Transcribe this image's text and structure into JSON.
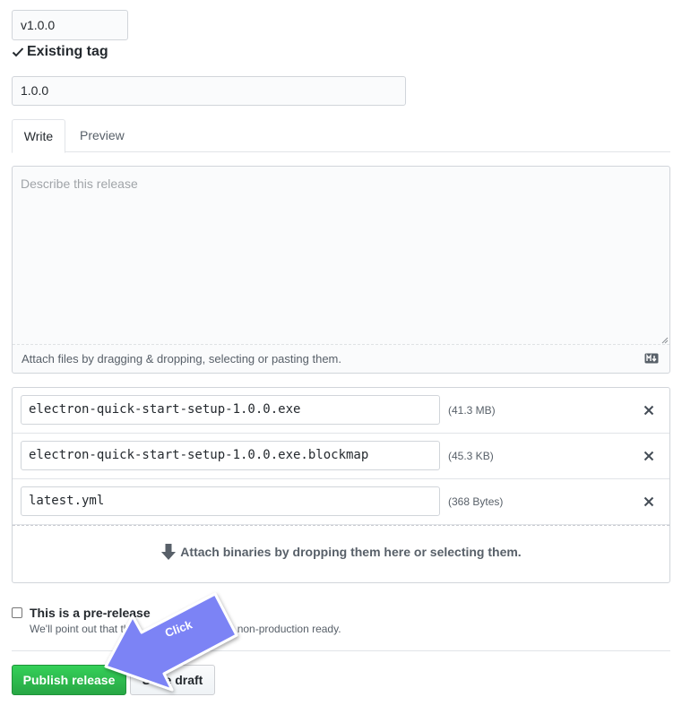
{
  "tag": {
    "value": "v1.0.0",
    "status": "Existing tag"
  },
  "release_title": {
    "value": "1.0.0"
  },
  "tabs": [
    {
      "label": "Write"
    },
    {
      "label": "Preview"
    }
  ],
  "editor": {
    "placeholder": "Describe this release",
    "attach_hint": "Attach files by dragging & dropping, selecting or pasting them."
  },
  "assets": [
    {
      "name": "electron-quick-start-setup-1.0.0.exe",
      "size": "(41.3 MB)"
    },
    {
      "name": "electron-quick-start-setup-1.0.0.exe.blockmap",
      "size": "(45.3 KB)"
    },
    {
      "name": "latest.yml",
      "size": "(368 Bytes)"
    }
  ],
  "dropzone": {
    "text": "Attach binaries by dropping them here or selecting them."
  },
  "prerelease": {
    "label": "This is a pre-release",
    "note_a": "We'll point out that th",
    "note_b": "ed as non-production ready."
  },
  "buttons": {
    "publish": "Publish release",
    "save_draft": "Save draft"
  },
  "annotation": {
    "label": "Click",
    "color": "#7b83f5"
  },
  "colors": {
    "accent_green": "#2ea44f",
    "border": "#d1d5da"
  }
}
